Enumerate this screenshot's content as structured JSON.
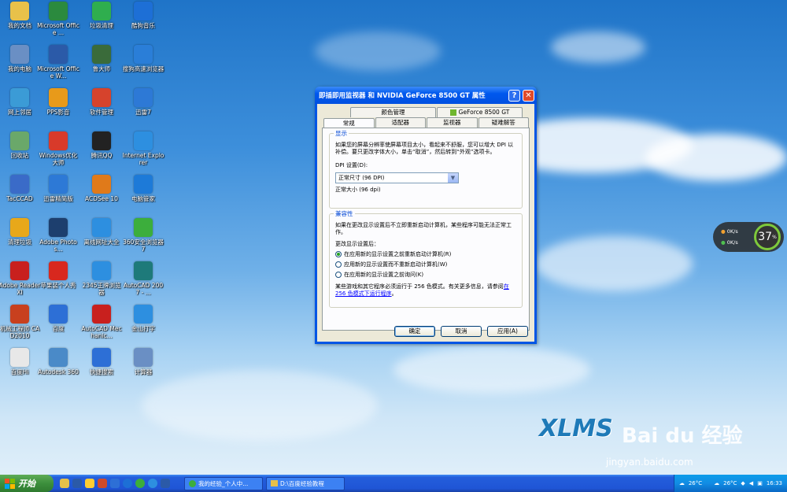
{
  "desktop": {
    "icons": [
      {
        "label": "我的文档",
        "icon": "folder-icon",
        "color": "#e8c14a"
      },
      {
        "label": "Microsoft Office ...",
        "icon": "excel-icon",
        "color": "#2b8a3e"
      },
      {
        "label": "垃圾清理",
        "icon": "broom-icon",
        "color": "#2fae4e"
      },
      {
        "label": "酷狗音乐",
        "icon": "kugou-icon",
        "color": "#1d6fd6"
      },
      {
        "label": "我的电脑",
        "icon": "computer-icon",
        "color": "#6a8fc4"
      },
      {
        "label": "Microsoft Office W...",
        "icon": "word-icon",
        "color": "#2b5aa8"
      },
      {
        "label": "鲁大师",
        "icon": "ludashi-icon",
        "color": "#3a6b3a"
      },
      {
        "label": "搜狗高速浏览器",
        "icon": "sogou-browser-icon",
        "color": "#2a7ed8"
      },
      {
        "label": "网上邻居",
        "icon": "network-icon",
        "color": "#3b9bd6"
      },
      {
        "label": "PPS影音",
        "icon": "pps-icon",
        "color": "#e89a1a"
      },
      {
        "label": "软件管理",
        "icon": "software-manager-icon",
        "color": "#d6432c"
      },
      {
        "label": "迅雷7",
        "icon": "xunlei-icon",
        "color": "#2d79d6"
      },
      {
        "label": "回收站",
        "icon": "recycle-bin-icon",
        "color": "#6aa86a"
      },
      {
        "label": "Windows优化大师",
        "icon": "optimizer-icon",
        "color": "#d83a2a"
      },
      {
        "label": "腾讯QQ",
        "icon": "qq-icon",
        "color": "#222222"
      },
      {
        "label": "Internet Explorer",
        "icon": "ie-icon",
        "color": "#2d8fe0"
      },
      {
        "label": "TacCCAD",
        "icon": "cad-icon",
        "color": "#3a6bc8"
      },
      {
        "label": "迅雷精简版",
        "icon": "xunlei-lite-icon",
        "color": "#2d79d6"
      },
      {
        "label": "ACDSee 10",
        "icon": "acdsee-icon",
        "color": "#e07a1a"
      },
      {
        "label": "电脑管家",
        "icon": "pc-manager-icon",
        "color": "#1d7ad8"
      },
      {
        "label": "清理垃圾",
        "icon": "cleanup-icon",
        "color": "#e8a81a"
      },
      {
        "label": "Adobe Photos...",
        "icon": "photoshop-icon",
        "color": "#1d3f6e"
      },
      {
        "label": "离线网址大全",
        "icon": "ie-shortcut-icon",
        "color": "#2d8fe0"
      },
      {
        "label": "360安全浏览器7",
        "icon": "360-browser-icon",
        "color": "#3cae3c"
      },
      {
        "label": "Adobe Reader XI",
        "icon": "pdf-icon",
        "color": "#c8201e"
      },
      {
        "label": "苹果装个人秀",
        "icon": "apple-icon",
        "color": "#d8281e"
      },
      {
        "label": "2345王牌浏览器",
        "icon": "2345-browser-icon",
        "color": "#2d8fe0"
      },
      {
        "label": "AutoCAD 2007 - ...",
        "icon": "autocad-icon",
        "color": "#1e7a7a"
      },
      {
        "label": "机械工程师 CAD2010",
        "icon": "mech-cad-icon",
        "color": "#c8401e"
      },
      {
        "label": "百度",
        "icon": "baidu-icon",
        "color": "#2d6fd6"
      },
      {
        "label": "AutoCAD Mechanic...",
        "icon": "autocad-mech-icon",
        "color": "#c8201e"
      },
      {
        "label": "金山打字",
        "icon": "typing-icon",
        "color": "#2d8fe0"
      },
      {
        "label": "百度Hi",
        "icon": "baidu-hi-icon",
        "color": "#e8e8e8"
      },
      {
        "label": "Autodesk 360",
        "icon": "autodesk-icon",
        "color": "#4a8ac8"
      },
      {
        "label": "快捷搜索",
        "icon": "quick-search-icon",
        "color": "#2d6fd6"
      },
      {
        "label": "计算器",
        "icon": "calculator-icon",
        "color": "#6a8fc4"
      }
    ]
  },
  "dialog": {
    "title": "即插即用监视器 和 NVIDIA GeForce 8500 GT 属性",
    "help_label": "?",
    "close_label": "✕",
    "tabs_row1": [
      "颜色管理",
      "GeForce 8500 GT"
    ],
    "tabs_row2": [
      "常规",
      "适配器",
      "监视器",
      "疑难解答"
    ],
    "display_group": {
      "title": "显示",
      "desc": "如果您的屏幕分辨率使屏幕项目太小，看起来不舒服，您可以增大 DPI 以补偿。要只更改字体大小，单击“取消”，然后转到“外观”选项卡。",
      "dpi_label": "DPI 设置(D):",
      "dpi_value": "正常尺寸 (96 DPI)",
      "dpi_note": "正常大小 (96 dpi)"
    },
    "compat_group": {
      "title": "兼容性",
      "desc": "如果在更改显示设置后不立即重新启动计算机，某些程序可能无法正常工作。",
      "after_label": "更改显示设置后：",
      "options": [
        {
          "label": "在应用新的显示设置之前重新启动计算机(R)",
          "selected": true
        },
        {
          "label": "应用新的显示设置而不重新启动计算机(W)",
          "selected": false
        },
        {
          "label": "在应用新的显示设置之前询问(K)",
          "selected": false
        }
      ],
      "footer_text": "某些游戏和其它程序必须运行于 256 色模式。有关更多信息，请参阅",
      "footer_link": "在 256 色模式下运行程序",
      "footer_end": "。"
    },
    "buttons": {
      "ok": "确定",
      "cancel": "取消",
      "apply": "应用(A)"
    }
  },
  "gadget": {
    "percent": "37",
    "unit": "%",
    "up": "0K/s",
    "down": "0K/s"
  },
  "watermark": {
    "brand": "XLMS",
    "site": "Bai du 经验",
    "url": "jingyan.baidu.com"
  },
  "taskbar": {
    "start_label": "开始",
    "tasks": [
      "我的经验_个人中...",
      "D:\\百度经验教程"
    ],
    "weather1": "26°C",
    "weather2": "26°C",
    "clock": "16:33"
  }
}
